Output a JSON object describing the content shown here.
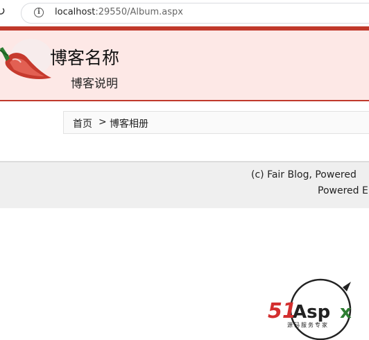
{
  "browser": {
    "url_host": "localhost",
    "url_port_path": ":29550/Album.aspx"
  },
  "blog": {
    "title": "博客名称",
    "subtitle": "博客说明"
  },
  "breadcrumb": {
    "home": "首页",
    "separator": ">",
    "current": "博客相册"
  },
  "footer": {
    "line1": "(c) Fair Blog, Powered",
    "line2": "Powered E"
  },
  "watermark": {
    "brand": "51Aspx",
    "tagline": "源码服务专家"
  },
  "colors": {
    "accent": "#c0392b",
    "header_bg": "#fde8e6",
    "footer_bg": "#efefef"
  }
}
